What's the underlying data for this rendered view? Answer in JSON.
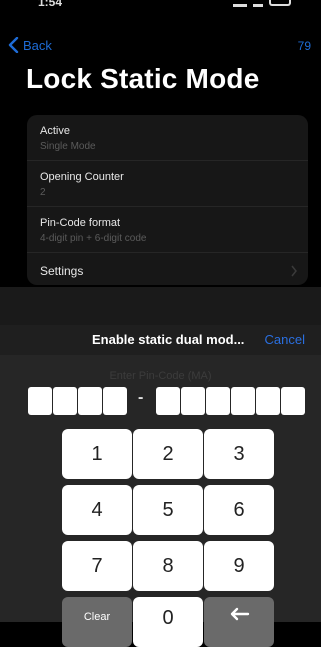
{
  "status": {
    "time": "1:54"
  },
  "nav": {
    "back_label": "Back",
    "count": "79"
  },
  "page": {
    "title": "Lock Static Mode"
  },
  "settings_rows": [
    {
      "label": "Active",
      "value": "Single Mode"
    },
    {
      "label": "Opening Counter",
      "value": "2"
    },
    {
      "label": "Pin-Code format",
      "value": "4-digit pin + 6-digit code"
    },
    {
      "label": "Settings"
    }
  ],
  "sheet": {
    "title": "Enable static dual mod...",
    "cancel_label": "Cancel",
    "pin_prompt": "Enter Pin-Code (MA)",
    "pin_dash": "-"
  },
  "keypad": {
    "keys": [
      "1",
      "2",
      "3",
      "4",
      "5",
      "6",
      "7",
      "8",
      "9"
    ],
    "clear_label": "Clear",
    "zero_label": "0"
  },
  "colors": {
    "accent": "#1e6cd6",
    "card_bg": "#171717",
    "sheet_bg": "#262626"
  },
  "icons": {
    "back": "chevron-left-icon",
    "row": "chevron-right-icon",
    "delete": "backspace-icon"
  }
}
